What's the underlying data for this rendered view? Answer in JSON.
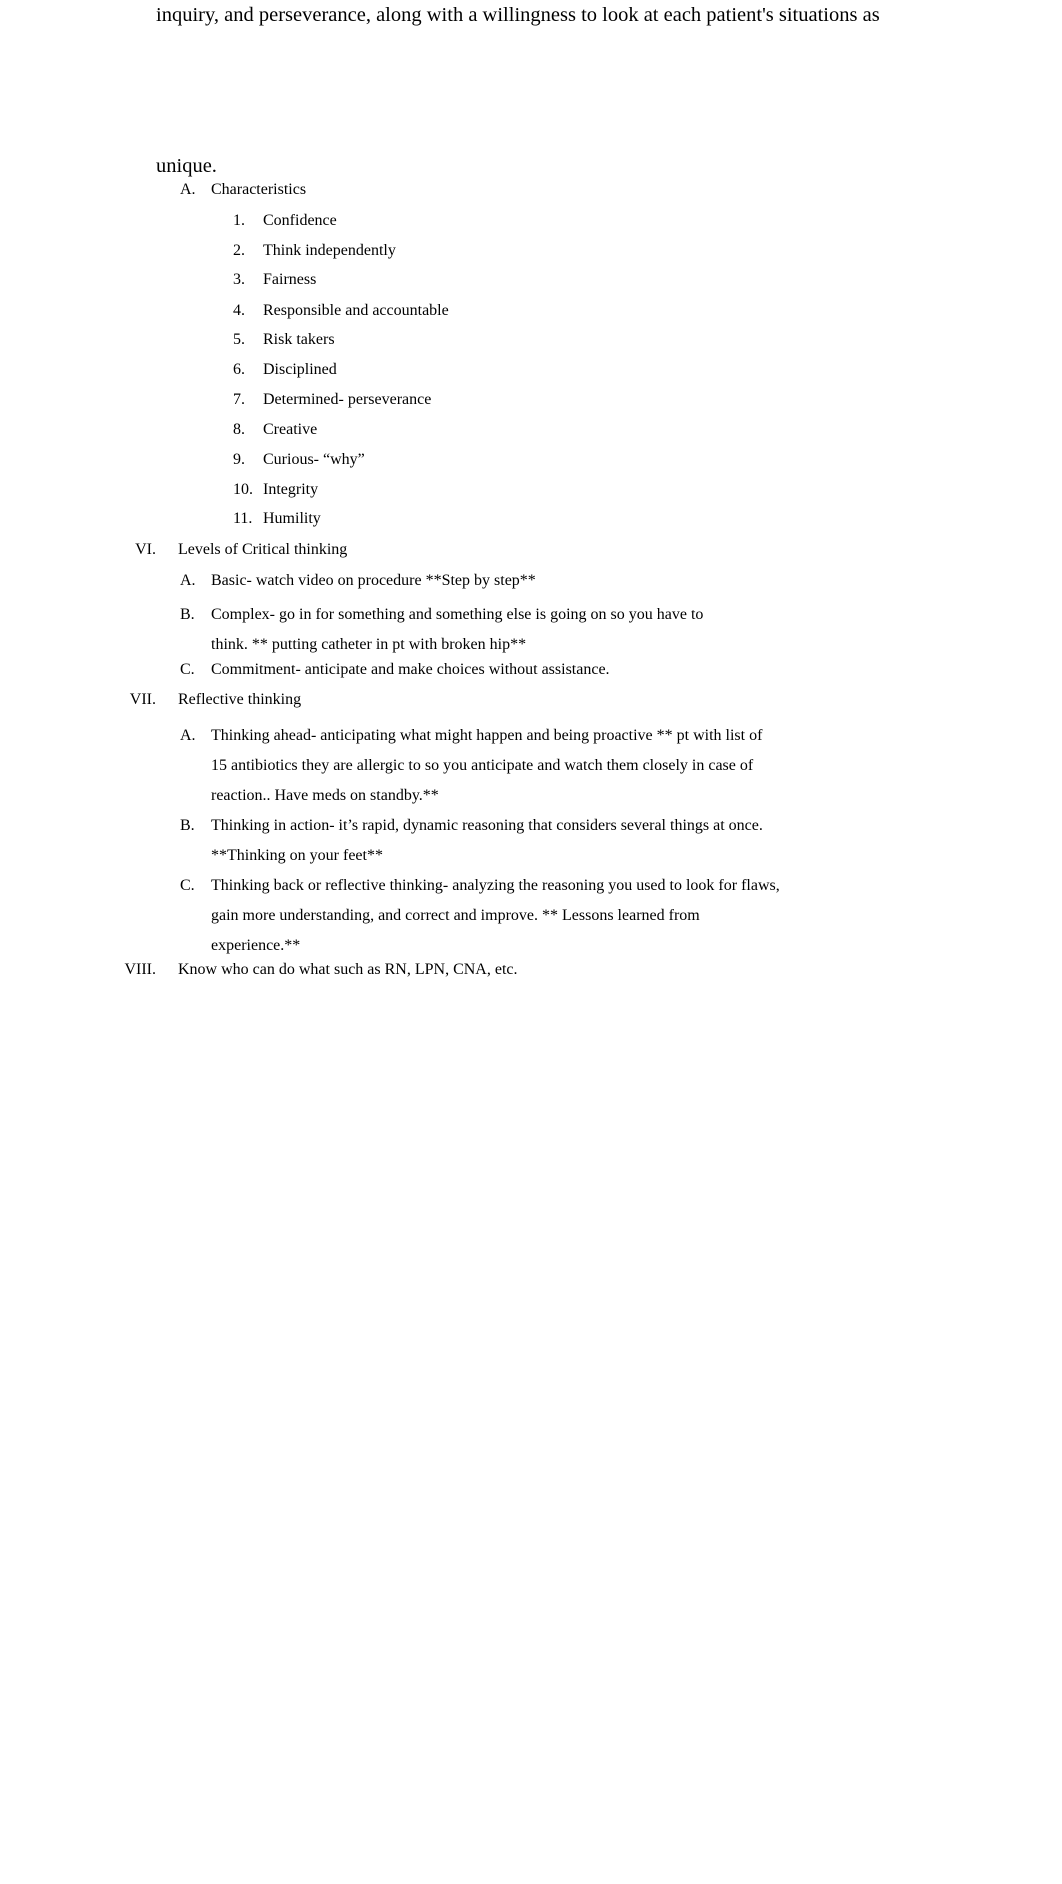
{
  "document": {
    "font_color": "#000000",
    "background": "#ffffff",
    "top_paragraph_continuation": "inquiry, and perseverance, along with a willingness to look at each patient's situations as",
    "orphan_line": "unique."
  },
  "outline": {
    "characteristics_section": {
      "marker": "A.",
      "label": "Characteristics",
      "items": [
        {
          "marker": "1.",
          "text": "Confidence"
        },
        {
          "marker": "2.",
          "text": "Think independently"
        },
        {
          "marker": "3.",
          "text": "Fairness"
        },
        {
          "marker": "4.",
          "text": "Responsible and accountable"
        },
        {
          "marker": "5.",
          "text": "Risk takers"
        },
        {
          "marker": "6.",
          "text": "Disciplined"
        },
        {
          "marker": "7.",
          "text": "Determined- perseverance"
        },
        {
          "marker": "8.",
          "text": "Creative"
        },
        {
          "marker": "9.",
          "text": "Curious- “why”"
        },
        {
          "marker": "10.",
          "text": "Integrity"
        },
        {
          "marker": "11.",
          "text": "Humility"
        }
      ]
    },
    "sections": [
      {
        "marker": "VI.",
        "title": "Levels of Critical thinking",
        "subitems": [
          {
            "marker": "A.",
            "text": "Basic- watch video on procedure **Step by step**"
          },
          {
            "marker": "B.",
            "text": "Complex- go in for something and something else is going on so you have to think. ** putting catheter in pt with broken hip**"
          },
          {
            "marker": "C.",
            "text": "Commitment- anticipate and make choices without assistance."
          }
        ]
      },
      {
        "marker": "VII.",
        "title": "Reflective thinking",
        "subitems": [
          {
            "marker": "A.",
            "text": "Thinking ahead- anticipating what might happen and being proactive ** pt with list of 15 antibiotics they are allergic to so you anticipate and watch them closely in case of reaction.. Have meds on standby.**"
          },
          {
            "marker": "B.",
            "text": "Thinking in action- it’s rapid, dynamic reasoning that considers several things at once. **Thinking on your feet**"
          },
          {
            "marker": "C.",
            "text": "Thinking back or reflective thinking- analyzing the reasoning you used to look for flaws, gain more understanding, and correct and improve. ** Lessons learned from experience.**"
          }
        ]
      },
      {
        "marker": "VIII.",
        "title": "Know who can do what such as RN, LPN, CNA, etc.",
        "subitems": []
      }
    ]
  }
}
